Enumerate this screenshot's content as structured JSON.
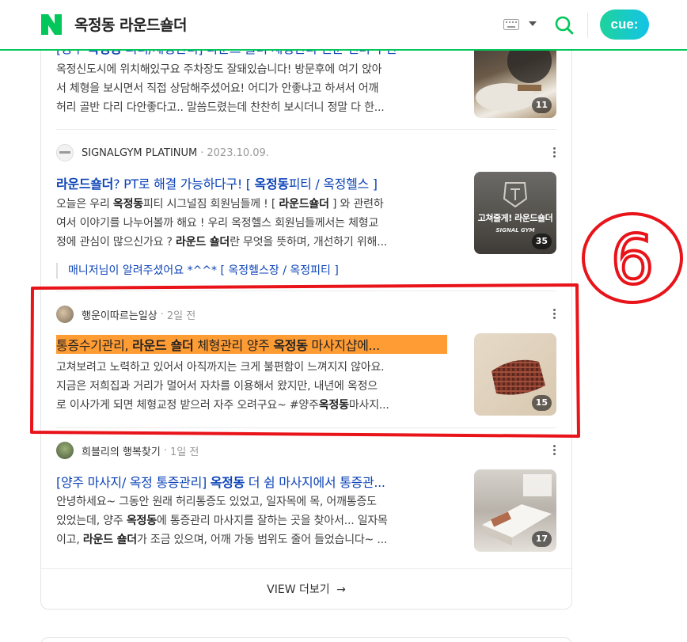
{
  "header": {
    "query": "옥정동 라운드숄더",
    "cue_label": "cue:",
    "brand_color": "#03c75a"
  },
  "posts": [
    {
      "title_pre": "[양주 ",
      "title_kw": "옥정동",
      "title_post": " 피티/체형관리] 라운드 숄더 체형관리 전문 센터 추천",
      "desc1": "옥정신도시에 위치해있구요 주차장도 잘돼있습니다! 방문후에 여기 앉아",
      "desc2": "서 체형을 보시면서 직접 상담해주셨어요! 어디가 안좋냐고 하셔서 어깨",
      "desc3": "허리 골반 다리 다안좋다고.. 말씀드렸는데 찬찬히 보시더니 정말 다 한...",
      "count": "11"
    },
    {
      "author": "SIGNALGYM PLATINUM",
      "date": "2023.10.09.",
      "title_a": "라운드숄더",
      "title_b": "? PT로 해결 가능하다구! [ ",
      "title_c": "옥정동",
      "title_d": "피티 / 옥정헬스 ]",
      "desc1_a": "오늘은 우리 ",
      "desc1_b": "옥정동",
      "desc1_c": "피티 시그널짐 회원님들께 ! [ ",
      "desc1_d": "라운드숄더",
      "desc1_e": " ] 와 관련하",
      "desc2": "여서 이야기를 나누어볼까 해요 ! 우리 옥정헬스 회원님들께서는 체형교",
      "desc3_a": "정에 관심이 많으신가요 ? ",
      "desc3_b": "라운드 숄더",
      "desc3_c": "란 무엇을 뜻하며, 개선하기 위해...",
      "thumb_text1": "고쳐줄게! 라운드숄더",
      "thumb_text2": "SIGNAL GYM",
      "count": "35",
      "subline": "매니저님이 알려주셨어요 *^^* [ 옥정헬스장 / 옥정피티 ]"
    },
    {
      "author": "행운이따르는일상",
      "date": "2일 전",
      "title_a": "통증수기관리, ",
      "title_b": "라운드 숄더",
      "title_c": " 체형관리 양주 ",
      "title_d": "옥정동",
      "title_e": " 마사지샵에...",
      "desc1": "고쳐보려고 노력하고 있어서 아직까지는 크게 불편함이 느껴지지 않아요.",
      "desc2": "지금은 저희집과 거리가 멀어서 자차를 이용해서 왔지만, 내년에 옥정으",
      "desc3_a": "로 이사가게 되면 체형교정 받으러 자주 오려구요~ #양주",
      "desc3_b": "옥정동",
      "desc3_c": "마사지...",
      "count": "15",
      "highlight_color": "#ff9c34"
    },
    {
      "author": "희블리의 행복찾기",
      "date": "1일 전",
      "title_a": "[양주 마사지/ 옥정 통증관리] ",
      "title_b": "옥정동",
      "title_c": " 더 쉼 마사지에서 통증관...",
      "desc1": "안녕하세요~ 그동안 원래 허리통증도 있었고, 일자목에 목, 어깨통증도",
      "desc2_a": "있었는데, 양주 ",
      "desc2_b": "옥정동",
      "desc2_c": "에 통증관리 마사지를 잘하는 곳을 찾아서... 일자목",
      "desc3_a": "이고, ",
      "desc3_b": "라운드 숄더",
      "desc3_c": "가 조금 있으며, 어깨 가동 범위도 줄어 들었습니다~ ...",
      "count": "17"
    }
  ],
  "viewmore": {
    "label": "VIEW 더보기"
  },
  "annotation": {
    "number": "6",
    "color": "#e8141a"
  }
}
